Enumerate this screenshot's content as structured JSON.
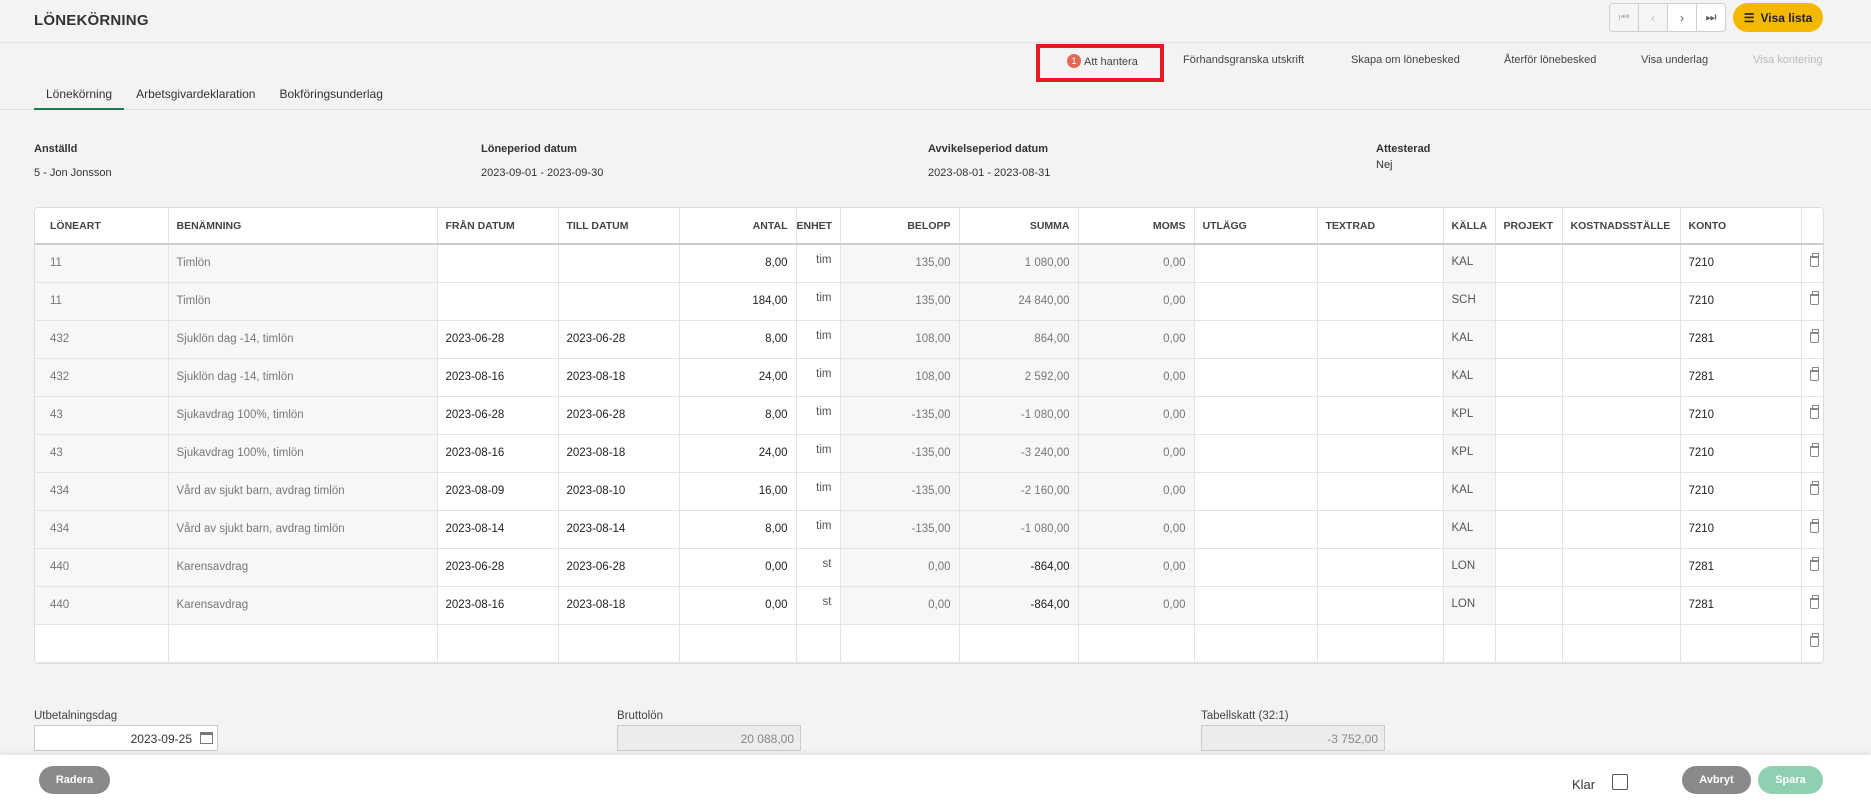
{
  "header": {
    "title": "LÖNEKÖRNING",
    "visa_lista": "Visa lista",
    "nav": [
      "first",
      "prev",
      "next",
      "last"
    ]
  },
  "actions": {
    "att_hantera": "Att hantera",
    "att_hantera_count": "1",
    "forhandsgranska": "Förhandsgranska utskrift",
    "skapa_om": "Skapa om lönebesked",
    "aterfor": "Återför lönebesked",
    "visa_underlag": "Visa underlag",
    "visa_kontering": "Visa kontering"
  },
  "tabs": [
    "Lönekörning",
    "Arbetsgivardeklaration",
    "Bokföringsunderlag"
  ],
  "info": {
    "anstalld_label": "Anställd",
    "anstalld_value": "5 - Jon Jonsson",
    "loneperiod_label": "Löneperiod datum",
    "loneperiod_value": "2023-09-01 - 2023-09-30",
    "avvikelse_label": "Avvikelseperiod datum",
    "avvikelse_value": "2023-08-01 - 2023-08-31",
    "attesterad_label": "Attesterad",
    "attesterad_value": "Nej"
  },
  "table": {
    "columns": [
      "LÖNEART",
      "BENÄMNING",
      "FRÅN DATUM",
      "TILL DATUM",
      "ANTAL",
      "ENHET",
      "BELOPP",
      "SUMMA",
      "MOMS",
      "UTLÄGG",
      "TEXTRAD",
      "KÄLLA",
      "PROJEKT",
      "KOSTNADSSTÄLLE",
      "KONTO"
    ],
    "rows": [
      [
        "11",
        "Timlön",
        "",
        "",
        "8,00",
        "tim",
        "135,00",
        "1 080,00",
        "0,00",
        "",
        "",
        "KAL",
        "",
        "",
        "7210"
      ],
      [
        "11",
        "Timlön",
        "",
        "",
        "184,00",
        "tim",
        "135,00",
        "24 840,00",
        "0,00",
        "",
        "",
        "SCH",
        "",
        "",
        "7210"
      ],
      [
        "432",
        "Sjuklön dag -14, timlön",
        "2023-06-28",
        "2023-06-28",
        "8,00",
        "tim",
        "108,00",
        "864,00",
        "0,00",
        "",
        "",
        "KAL",
        "",
        "",
        "7281"
      ],
      [
        "432",
        "Sjuklön dag -14, timlön",
        "2023-08-16",
        "2023-08-18",
        "24,00",
        "tim",
        "108,00",
        "2 592,00",
        "0,00",
        "",
        "",
        "KAL",
        "",
        "",
        "7281"
      ],
      [
        "43",
        "Sjukavdrag 100%, timlön",
        "2023-06-28",
        "2023-06-28",
        "8,00",
        "tim",
        "-135,00",
        "-1 080,00",
        "0,00",
        "",
        "",
        "KPL",
        "",
        "",
        "7210"
      ],
      [
        "43",
        "Sjukavdrag 100%, timlön",
        "2023-08-16",
        "2023-08-18",
        "24,00",
        "tim",
        "-135,00",
        "-3 240,00",
        "0,00",
        "",
        "",
        "KPL",
        "",
        "",
        "7210"
      ],
      [
        "434",
        "Vård av sjukt barn, avdrag timlön",
        "2023-08-09",
        "2023-08-10",
        "16,00",
        "tim",
        "-135,00",
        "-2 160,00",
        "0,00",
        "",
        "",
        "KAL",
        "",
        "",
        "7210"
      ],
      [
        "434",
        "Vård av sjukt barn, avdrag timlön",
        "2023-08-14",
        "2023-08-14",
        "8,00",
        "tim",
        "-135,00",
        "-1 080,00",
        "0,00",
        "",
        "",
        "KAL",
        "",
        "",
        "7210"
      ],
      [
        "440",
        "Karensavdrag",
        "2023-06-28",
        "2023-06-28",
        "0,00",
        "st",
        "0,00",
        "-864,00",
        "0,00",
        "",
        "",
        "LON",
        "",
        "",
        "7281"
      ],
      [
        "440",
        "Karensavdrag",
        "2023-08-16",
        "2023-08-18",
        "0,00",
        "st",
        "0,00",
        "-864,00",
        "0,00",
        "",
        "",
        "LON",
        "",
        "",
        "7281"
      ]
    ]
  },
  "summary": {
    "utbetalningsdag_label": "Utbetalningsdag",
    "utbetalningsdag_value": "2023-09-25",
    "bruttolon_label": "Bruttolön",
    "bruttolon_value": "20 088,00",
    "tabellskatt_label": "Tabellskatt (32:1)",
    "tabellskatt_value": "-3 752,00"
  },
  "footer": {
    "radera": "Radera",
    "klar": "Klar",
    "avbryt": "Avbryt",
    "spara": "Spara"
  },
  "colors": {
    "accent_yellow": "#f5b800",
    "tab_active": "#1f7a4d",
    "highlight": "#e01b24",
    "badge": "#e06a55",
    "spara": "#8fd0b0",
    "grey_button": "#8a8a8a"
  }
}
